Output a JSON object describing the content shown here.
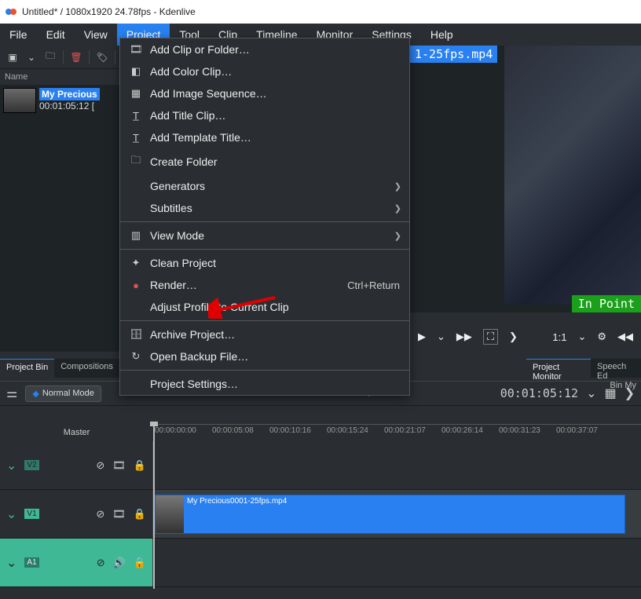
{
  "title": "Untitled* / 1080x1920 24.78fps - Kdenlive",
  "menu": {
    "file": "File",
    "edit": "Edit",
    "view": "View",
    "project": "Project",
    "tool": "Tool",
    "clip": "Clip",
    "timeline": "Timeline",
    "monitor": "Monitor",
    "settings": "Settings",
    "help": "Help"
  },
  "project_menu": {
    "add_clip": "Add Clip or Folder…",
    "add_color": "Add Color Clip…",
    "add_img_seq": "Add Image Sequence…",
    "add_title": "Add Title Clip…",
    "add_tmpl": "Add Template Title…",
    "create_folder": "Create Folder",
    "generators": "Generators",
    "subtitles": "Subtitles",
    "view_mode": "View Mode",
    "clean": "Clean Project",
    "render": "Render…",
    "render_short": "Ctrl+Return",
    "adjust": "Adjust Profile to Current Clip",
    "archive": "Archive Project…",
    "backup": "Open Backup File…",
    "psettings": "Project Settings…"
  },
  "bin": {
    "header": "Name",
    "clip_name": "My Precious",
    "clip_time": "00:01:05:12 ["
  },
  "monitor": {
    "file": "1-25fps.mp4",
    "in_point": "In Point",
    "zoom": "1:1"
  },
  "tabs_left": {
    "project_bin": "Project Bin",
    "compositions": "Compositions"
  },
  "tabs_right": {
    "project_monitor": "Project Monitor",
    "speech": "Speech Ed"
  },
  "mode": {
    "normal": "Normal Mode",
    "timecode": "00:01:05:12",
    "bin": "Bin My"
  },
  "ruler": {
    "master": "Master",
    "ticks": [
      "00:00:00:00",
      "00:00:05:08",
      "00:00:10:16",
      "00:00:15:24",
      "00:00:21:07",
      "00:00:26:14",
      "00:00:31:23",
      "00:00:37:07"
    ]
  },
  "tracks": {
    "v2": "V2",
    "v1": "V1",
    "a1": "A1",
    "clip_label": "My Precious0001-25fps.mp4"
  },
  "divider": "/"
}
